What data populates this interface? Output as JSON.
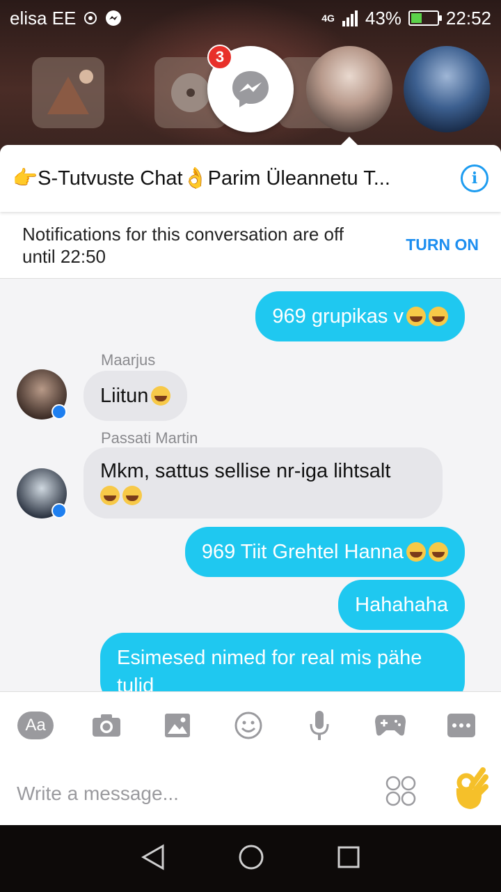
{
  "status_bar": {
    "carrier": "elisa EE",
    "network": "4G",
    "battery": "43%",
    "battery_level": 0.43,
    "time": "22:52"
  },
  "chat_heads": {
    "messenger_badge": "3"
  },
  "conversation": {
    "title": "👉S-Tutvuste Chat👌Parim Üleannetu T...",
    "info_label": "i"
  },
  "notice": {
    "text": "Notifications for this conversation are off until 22:50",
    "action": "TURN ON"
  },
  "messages": [
    {
      "type": "out",
      "text": "969 grupikas v"
    },
    {
      "type": "in",
      "sender": "Maarjus",
      "text": "Liitun"
    },
    {
      "type": "in",
      "sender": "Passati Martin",
      "text": "Mkm, sattus sellise nr-iga lihtsalt"
    },
    {
      "type": "out",
      "text": "969 Tiit Grehtel Hanna"
    },
    {
      "type": "out",
      "text": "Hahahaha"
    },
    {
      "type": "out",
      "text": "Esimesed nimed for real mis pähe tulid"
    }
  ],
  "composer": {
    "aa_label": "Aa",
    "placeholder": "Write a message...",
    "tools": [
      "text-format-icon",
      "camera-icon",
      "image-icon",
      "smiley-icon",
      "microphone-icon",
      "gamepad-icon",
      "more-icon"
    ]
  },
  "colors": {
    "accent": "#1d9cf0",
    "outgoing_bubble": "#1fc8f0",
    "incoming_bubble": "#e6e6ea",
    "badge": "#e8302a"
  }
}
